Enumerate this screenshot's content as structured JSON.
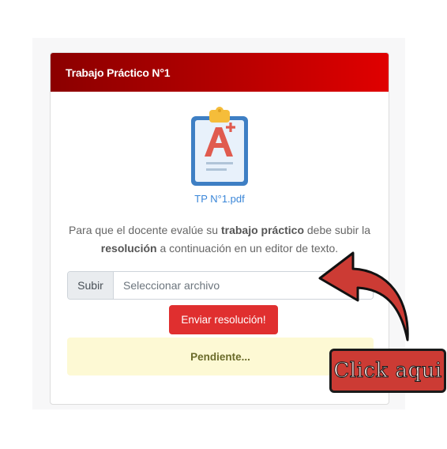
{
  "card": {
    "title": "Trabajo Práctico N°1",
    "file_link": "TP N°1.pdf",
    "description_parts": {
      "pre": "Para que el docente evalúe su ",
      "bold1": "trabajo práctico",
      "mid": " debe subir la",
      "bold2": "resolución",
      "post": " a continuación en un editor de texto."
    },
    "upload": {
      "button_label": "Subir",
      "placeholder": "Seleccionar archivo"
    },
    "submit_label": "Enviar resolución!",
    "status_text": "Pendiente..."
  },
  "annotation": {
    "callout_text": "Click aqui"
  },
  "icons": {
    "document": "clipboard-grade-a-plus-icon",
    "pointer": "curved-arrow-icon"
  },
  "colors": {
    "header_gradient_start": "#8b0000",
    "header_gradient_end": "#e00000",
    "link": "#3a86d8",
    "submit_button": "#e02f2f",
    "status_bg": "#fdf9d4",
    "callout_bg": "#cc3b34"
  }
}
